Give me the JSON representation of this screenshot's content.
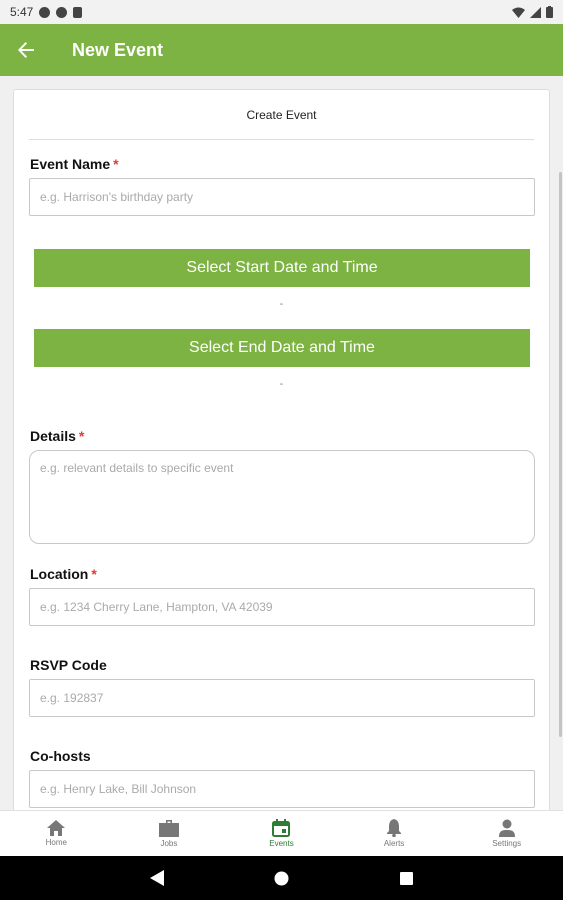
{
  "status_bar": {
    "time": "5:47"
  },
  "app_bar": {
    "title": "New Event"
  },
  "form": {
    "header": "Create Event",
    "event_name": {
      "label": "Event Name",
      "required_mark": "*",
      "placeholder": "e.g. Harrison's birthday party"
    },
    "start_button": "Select Start Date and Time",
    "start_value": "-",
    "end_button": "Select End Date and Time",
    "end_value": "-",
    "details": {
      "label": "Details",
      "required_mark": "*",
      "placeholder": "e.g. relevant details to specific event"
    },
    "location": {
      "label": "Location",
      "required_mark": "*",
      "placeholder": "e.g. 1234 Cherry Lane, Hampton, VA 42039"
    },
    "rsvp": {
      "label": "RSVP Code",
      "placeholder": "e.g. 192837"
    },
    "cohosts": {
      "label": "Co-hosts",
      "placeholder": "e.g. Henry Lake, Bill Johnson"
    }
  },
  "bottom_nav": {
    "items": [
      {
        "label": "Home",
        "icon": "home-icon"
      },
      {
        "label": "Jobs",
        "icon": "briefcase-icon"
      },
      {
        "label": "Events",
        "icon": "calendar-icon"
      },
      {
        "label": "Alerts",
        "icon": "bell-icon"
      },
      {
        "label": "Settings",
        "icon": "person-icon"
      }
    ],
    "active": "Events"
  },
  "colors": {
    "primary": "#7cb342",
    "active_nav": "#2e7d32",
    "required": "#e53935"
  }
}
